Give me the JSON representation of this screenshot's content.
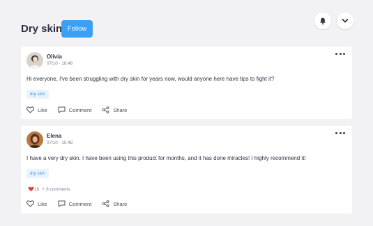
{
  "header": {
    "title": "Dry skin",
    "follow_label": "Follow",
    "icons": [
      "bell-icon",
      "chevron-down-icon"
    ]
  },
  "posts": [
    {
      "author": "Olivia",
      "time": "07/10 - 18:48",
      "text": "Hi everyone, I've been struggling with dry skin for years now, would anyone here have tips to fight it?",
      "tag": "dry skin",
      "actions": {
        "like": "Like",
        "comment": "Comment",
        "share": "Share"
      }
    },
    {
      "author": "Elena",
      "time": "07/10 - 15:48",
      "text": "I have a very dry skin. I have been using this product for months, and it has done miracles! I highly recommend it!",
      "tag": "dry skin",
      "reactions_count": "16",
      "comments_count": "8 comments",
      "actions": {
        "like": "Like",
        "comment": "Comment",
        "share": "Share"
      }
    }
  ],
  "colors": {
    "accent": "#3aa0f5",
    "background": "#f2f2f4",
    "tag_bg": "#eaf3fd",
    "tag_text": "#3b8fd9",
    "reaction_heart": "#e0413f"
  }
}
